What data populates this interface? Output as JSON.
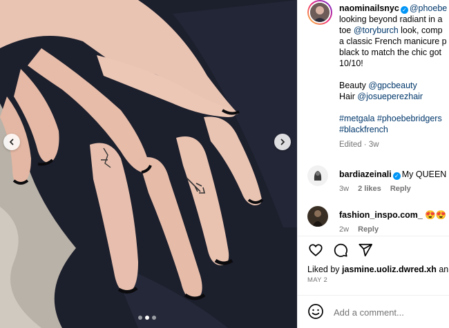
{
  "post": {
    "photo_icon": "hands-with-french-manicure-photo",
    "carousel": {
      "total": 3,
      "active": 1
    },
    "nav": {
      "prev_icon": "chevron-left-icon",
      "next_icon": "chevron-right-icon"
    }
  },
  "caption": {
    "username": "naominailsnyc",
    "mention": "@phoebe",
    "lines": [
      "looking beyond radiant in a",
      "a classic French manicure p",
      "black to match the chic got",
      "10/10!"
    ],
    "line2_prefix": "toe ",
    "line2_mention": "@toryburch",
    "line2_suffix": " look, comp",
    "beauty_label": "Beauty ",
    "beauty_mention": "@gpcbeauty",
    "hair_label": "Hair ",
    "hair_mention": "@josueperezhair",
    "hashtags_line1": "#metgala #phoebebridgers",
    "hashtags_line2": "#blackfrench",
    "edited": "Edited · 3w"
  },
  "comments": [
    {
      "username": "bardiazeinali",
      "text": "My QUEEN",
      "age": "3w",
      "likes": "2 likes",
      "reply": "Reply"
    },
    {
      "username": "fashion_inspo.com_",
      "text": "😍😍",
      "age": "2w",
      "reply": "Reply"
    }
  ],
  "actions": {
    "like_icon": "heart-icon",
    "comment_icon": "comment-icon",
    "share_icon": "send-icon"
  },
  "likes": {
    "prefix": "Liked by ",
    "user": "jasmine.uoliz.dwred.xh",
    "suffix": " an"
  },
  "date": "MAY 2",
  "add_comment": {
    "placeholder": "Add a comment...",
    "emoji_icon": "smiley-icon"
  },
  "colors": {
    "link": "#00376b",
    "muted": "#737373",
    "verified": "#0095f6"
  }
}
